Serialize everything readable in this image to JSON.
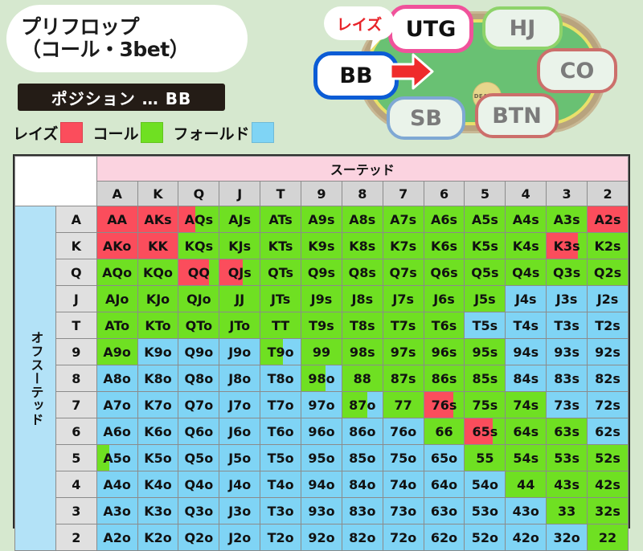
{
  "header": {
    "title_line1": "プリフロップ",
    "title_line2": "（コール・3bet）",
    "position_label": "ポジション … BB",
    "legend": [
      {
        "label": "レイズ",
        "color": "#fb4d5c"
      },
      {
        "label": "コール",
        "color": "#6fe022"
      },
      {
        "label": "フォールド",
        "color": "#7fd4f5"
      }
    ]
  },
  "table_diagram": {
    "raise_bubble": "レイズ",
    "dealer_button": "DEALER",
    "seats": [
      {
        "name": "UTG",
        "label": "UTG"
      },
      {
        "name": "HJ",
        "label": "HJ"
      },
      {
        "name": "CO",
        "label": "CO"
      },
      {
        "name": "BTN",
        "label": "BTN"
      },
      {
        "name": "SB",
        "label": "SB"
      },
      {
        "name": "BB",
        "label": "BB"
      }
    ],
    "hero_seat": "BB",
    "raiser_seat": "UTG"
  },
  "grid": {
    "suited_banner": "スーテッド",
    "offsuit_side": "オフスーテッド",
    "ranks": [
      "A",
      "K",
      "Q",
      "J",
      "T",
      "9",
      "8",
      "7",
      "6",
      "5",
      "4",
      "3",
      "2"
    ],
    "colors": {
      "raise": "#fb4d5c",
      "call": "#6fe022",
      "fold": "#7fd4f5"
    },
    "rows": [
      {
        "rank": "A",
        "cells": [
          {
            "hand": "AA",
            "action": "raise"
          },
          {
            "hand": "AKs",
            "action": "raise"
          },
          {
            "hand": "AQs",
            "action": "raise",
            "split": "call",
            "pct": 42
          },
          {
            "hand": "AJs",
            "action": "call"
          },
          {
            "hand": "ATs",
            "action": "call"
          },
          {
            "hand": "A9s",
            "action": "call"
          },
          {
            "hand": "A8s",
            "action": "call"
          },
          {
            "hand": "A7s",
            "action": "call"
          },
          {
            "hand": "A6s",
            "action": "call"
          },
          {
            "hand": "A5s",
            "action": "call"
          },
          {
            "hand": "A4s",
            "action": "call"
          },
          {
            "hand": "A3s",
            "action": "call"
          },
          {
            "hand": "A2s",
            "action": "raise"
          }
        ]
      },
      {
        "rank": "K",
        "cells": [
          {
            "hand": "AKo",
            "action": "raise"
          },
          {
            "hand": "KK",
            "action": "raise"
          },
          {
            "hand": "KQs",
            "action": "call"
          },
          {
            "hand": "KJs",
            "action": "call"
          },
          {
            "hand": "KTs",
            "action": "call"
          },
          {
            "hand": "K9s",
            "action": "call"
          },
          {
            "hand": "K8s",
            "action": "call"
          },
          {
            "hand": "K7s",
            "action": "call"
          },
          {
            "hand": "K6s",
            "action": "call"
          },
          {
            "hand": "K5s",
            "action": "call"
          },
          {
            "hand": "K4s",
            "action": "call"
          },
          {
            "hand": "K3s",
            "action": "raise",
            "split": "call",
            "pct": 78
          },
          {
            "hand": "K2s",
            "action": "call"
          }
        ]
      },
      {
        "rank": "Q",
        "cells": [
          {
            "hand": "AQo",
            "action": "call"
          },
          {
            "hand": "KQo",
            "action": "call"
          },
          {
            "hand": "QQ",
            "action": "raise",
            "split": "call",
            "pct": 76
          },
          {
            "hand": "QJs",
            "action": "raise",
            "split": "call",
            "pct": 58
          },
          {
            "hand": "QTs",
            "action": "call"
          },
          {
            "hand": "Q9s",
            "action": "call"
          },
          {
            "hand": "Q8s",
            "action": "call"
          },
          {
            "hand": "Q7s",
            "action": "call"
          },
          {
            "hand": "Q6s",
            "action": "call"
          },
          {
            "hand": "Q5s",
            "action": "call"
          },
          {
            "hand": "Q4s",
            "action": "call"
          },
          {
            "hand": "Q3s",
            "action": "call"
          },
          {
            "hand": "Q2s",
            "action": "call"
          }
        ]
      },
      {
        "rank": "J",
        "cells": [
          {
            "hand": "AJo",
            "action": "call"
          },
          {
            "hand": "KJo",
            "action": "call"
          },
          {
            "hand": "QJo",
            "action": "call"
          },
          {
            "hand": "JJ",
            "action": "call"
          },
          {
            "hand": "JTs",
            "action": "call"
          },
          {
            "hand": "J9s",
            "action": "call"
          },
          {
            "hand": "J8s",
            "action": "call"
          },
          {
            "hand": "J7s",
            "action": "call"
          },
          {
            "hand": "J6s",
            "action": "call"
          },
          {
            "hand": "J5s",
            "action": "call"
          },
          {
            "hand": "J4s",
            "action": "fold"
          },
          {
            "hand": "J3s",
            "action": "fold"
          },
          {
            "hand": "J2s",
            "action": "fold"
          }
        ]
      },
      {
        "rank": "T",
        "cells": [
          {
            "hand": "ATo",
            "action": "call"
          },
          {
            "hand": "KTo",
            "action": "call"
          },
          {
            "hand": "QTo",
            "action": "call"
          },
          {
            "hand": "JTo",
            "action": "call"
          },
          {
            "hand": "TT",
            "action": "call"
          },
          {
            "hand": "T9s",
            "action": "call"
          },
          {
            "hand": "T8s",
            "action": "call"
          },
          {
            "hand": "T7s",
            "action": "call"
          },
          {
            "hand": "T6s",
            "action": "call"
          },
          {
            "hand": "T5s",
            "action": "fold"
          },
          {
            "hand": "T4s",
            "action": "fold"
          },
          {
            "hand": "T3s",
            "action": "fold"
          },
          {
            "hand": "T2s",
            "action": "fold"
          }
        ]
      },
      {
        "rank": "9",
        "cells": [
          {
            "hand": "A9o",
            "action": "call"
          },
          {
            "hand": "K9o",
            "action": "fold"
          },
          {
            "hand": "Q9o",
            "action": "fold"
          },
          {
            "hand": "J9o",
            "action": "fold"
          },
          {
            "hand": "T9o",
            "action": "call",
            "split": "fold",
            "pct": 55
          },
          {
            "hand": "99",
            "action": "call"
          },
          {
            "hand": "98s",
            "action": "call"
          },
          {
            "hand": "97s",
            "action": "call"
          },
          {
            "hand": "96s",
            "action": "call"
          },
          {
            "hand": "95s",
            "action": "call"
          },
          {
            "hand": "94s",
            "action": "fold"
          },
          {
            "hand": "93s",
            "action": "fold"
          },
          {
            "hand": "92s",
            "action": "fold"
          }
        ]
      },
      {
        "rank": "8",
        "cells": [
          {
            "hand": "A8o",
            "action": "fold"
          },
          {
            "hand": "K8o",
            "action": "fold"
          },
          {
            "hand": "Q8o",
            "action": "fold"
          },
          {
            "hand": "J8o",
            "action": "fold"
          },
          {
            "hand": "T8o",
            "action": "fold"
          },
          {
            "hand": "98o",
            "action": "call",
            "split": "fold",
            "pct": 60
          },
          {
            "hand": "88",
            "action": "call"
          },
          {
            "hand": "87s",
            "action": "call"
          },
          {
            "hand": "86s",
            "action": "call"
          },
          {
            "hand": "85s",
            "action": "call"
          },
          {
            "hand": "84s",
            "action": "fold"
          },
          {
            "hand": "83s",
            "action": "fold"
          },
          {
            "hand": "82s",
            "action": "fold"
          }
        ]
      },
      {
        "rank": "7",
        "cells": [
          {
            "hand": "A7o",
            "action": "fold"
          },
          {
            "hand": "K7o",
            "action": "fold"
          },
          {
            "hand": "Q7o",
            "action": "fold"
          },
          {
            "hand": "J7o",
            "action": "fold"
          },
          {
            "hand": "T7o",
            "action": "fold"
          },
          {
            "hand": "97o",
            "action": "fold"
          },
          {
            "hand": "87o",
            "action": "call",
            "split": "fold",
            "pct": 62
          },
          {
            "hand": "77",
            "action": "call"
          },
          {
            "hand": "76s",
            "action": "raise",
            "split": "call",
            "pct": 74
          },
          {
            "hand": "75s",
            "action": "call"
          },
          {
            "hand": "74s",
            "action": "call"
          },
          {
            "hand": "73s",
            "action": "fold"
          },
          {
            "hand": "72s",
            "action": "fold"
          }
        ]
      },
      {
        "rank": "6",
        "cells": [
          {
            "hand": "A6o",
            "action": "fold"
          },
          {
            "hand": "K6o",
            "action": "fold"
          },
          {
            "hand": "Q6o",
            "action": "fold"
          },
          {
            "hand": "J6o",
            "action": "fold"
          },
          {
            "hand": "T6o",
            "action": "fold"
          },
          {
            "hand": "96o",
            "action": "fold"
          },
          {
            "hand": "86o",
            "action": "fold"
          },
          {
            "hand": "76o",
            "action": "fold"
          },
          {
            "hand": "66",
            "action": "call"
          },
          {
            "hand": "65s",
            "action": "raise",
            "split": "call",
            "pct": 70
          },
          {
            "hand": "64s",
            "action": "call"
          },
          {
            "hand": "63s",
            "action": "call"
          },
          {
            "hand": "62s",
            "action": "fold"
          }
        ]
      },
      {
        "rank": "5",
        "cells": [
          {
            "hand": "A5o",
            "action": "call",
            "split": "fold",
            "pct": 30
          },
          {
            "hand": "K5o",
            "action": "fold"
          },
          {
            "hand": "Q5o",
            "action": "fold"
          },
          {
            "hand": "J5o",
            "action": "fold"
          },
          {
            "hand": "T5o",
            "action": "fold"
          },
          {
            "hand": "95o",
            "action": "fold"
          },
          {
            "hand": "85o",
            "action": "fold"
          },
          {
            "hand": "75o",
            "action": "fold"
          },
          {
            "hand": "65o",
            "action": "fold"
          },
          {
            "hand": "55",
            "action": "call"
          },
          {
            "hand": "54s",
            "action": "call"
          },
          {
            "hand": "53s",
            "action": "call"
          },
          {
            "hand": "52s",
            "action": "call"
          }
        ]
      },
      {
        "rank": "4",
        "cells": [
          {
            "hand": "A4o",
            "action": "fold"
          },
          {
            "hand": "K4o",
            "action": "fold"
          },
          {
            "hand": "Q4o",
            "action": "fold"
          },
          {
            "hand": "J4o",
            "action": "fold"
          },
          {
            "hand": "T4o",
            "action": "fold"
          },
          {
            "hand": "94o",
            "action": "fold"
          },
          {
            "hand": "84o",
            "action": "fold"
          },
          {
            "hand": "74o",
            "action": "fold"
          },
          {
            "hand": "64o",
            "action": "fold"
          },
          {
            "hand": "54o",
            "action": "fold"
          },
          {
            "hand": "44",
            "action": "call"
          },
          {
            "hand": "43s",
            "action": "call"
          },
          {
            "hand": "42s",
            "action": "call"
          }
        ]
      },
      {
        "rank": "3",
        "cells": [
          {
            "hand": "A3o",
            "action": "fold"
          },
          {
            "hand": "K3o",
            "action": "fold"
          },
          {
            "hand": "Q3o",
            "action": "fold"
          },
          {
            "hand": "J3o",
            "action": "fold"
          },
          {
            "hand": "T3o",
            "action": "fold"
          },
          {
            "hand": "93o",
            "action": "fold"
          },
          {
            "hand": "83o",
            "action": "fold"
          },
          {
            "hand": "73o",
            "action": "fold"
          },
          {
            "hand": "63o",
            "action": "fold"
          },
          {
            "hand": "53o",
            "action": "fold"
          },
          {
            "hand": "43o",
            "action": "fold"
          },
          {
            "hand": "33",
            "action": "call"
          },
          {
            "hand": "32s",
            "action": "call"
          }
        ]
      },
      {
        "rank": "2",
        "cells": [
          {
            "hand": "A2o",
            "action": "fold"
          },
          {
            "hand": "K2o",
            "action": "fold"
          },
          {
            "hand": "Q2o",
            "action": "fold"
          },
          {
            "hand": "J2o",
            "action": "fold"
          },
          {
            "hand": "T2o",
            "action": "fold"
          },
          {
            "hand": "92o",
            "action": "fold"
          },
          {
            "hand": "82o",
            "action": "fold"
          },
          {
            "hand": "72o",
            "action": "fold"
          },
          {
            "hand": "62o",
            "action": "fold"
          },
          {
            "hand": "52o",
            "action": "fold"
          },
          {
            "hand": "42o",
            "action": "fold"
          },
          {
            "hand": "32o",
            "action": "fold"
          },
          {
            "hand": "22",
            "action": "call"
          }
        ]
      }
    ]
  }
}
